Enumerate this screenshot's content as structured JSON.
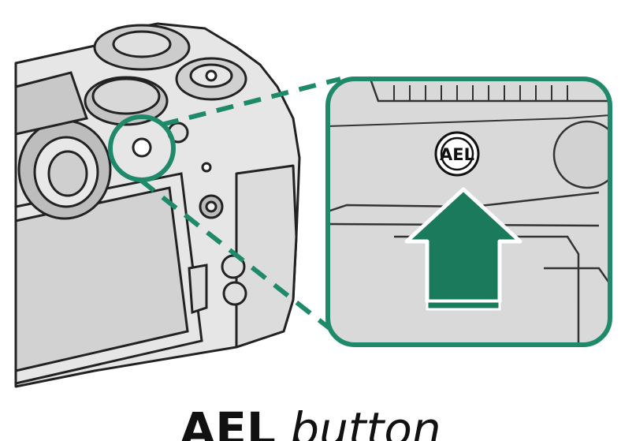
{
  "caption": {
    "button_name": "AEL",
    "suffix": "button"
  },
  "button_label": "AEL",
  "icons": [
    "camera-body",
    "ael-button-icon",
    "press-arrow-icon"
  ],
  "colors": {
    "accent_green": "#1e8a6a",
    "arrow_green": "#1c7a5c",
    "line": "#222222",
    "background": "#ffffff",
    "panel_fill": "#d9d9d9"
  }
}
